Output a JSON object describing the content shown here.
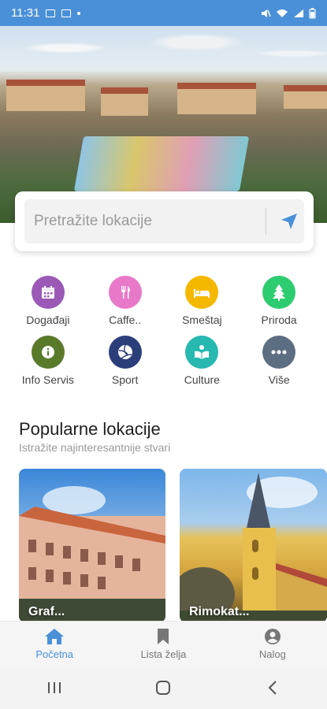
{
  "status_bar": {
    "time": "11:31"
  },
  "colors": {
    "accent": "#4a90d9",
    "statusbar": "#4a90d9"
  },
  "search": {
    "placeholder": "Pretražite lokacije",
    "locate_icon": "navigation-arrow-icon"
  },
  "categories": [
    {
      "label": "Događaji",
      "icon": "calendar-icon",
      "color": "#9b59b6"
    },
    {
      "label": "Caffe..",
      "icon": "cutlery-icon",
      "color": "#e879c9"
    },
    {
      "label": "Smeštaj",
      "icon": "bed-icon",
      "color": "#f5b800"
    },
    {
      "label": "Priroda",
      "icon": "tree-icon",
      "color": "#2ecc71"
    },
    {
      "label": "Info Servis",
      "icon": "info-icon",
      "color": "#5a7a2a"
    },
    {
      "label": "Sport",
      "icon": "volleyball-icon",
      "color": "#2c3e7a"
    },
    {
      "label": "Culture",
      "icon": "book-reader-icon",
      "color": "#27b8b0"
    },
    {
      "label": "Više",
      "icon": "more-dots-icon",
      "color": "#5e6e82"
    }
  ],
  "popular": {
    "title": "Popularne lokacije",
    "subtitle": "Istražite najinteresantnije stvari",
    "cards": [
      {
        "label": "Graf..."
      },
      {
        "label": "Rimokat..."
      }
    ]
  },
  "bottom_nav": [
    {
      "label": "Početna",
      "icon": "home-icon",
      "active": true
    },
    {
      "label": "Lista želja",
      "icon": "bookmark-icon",
      "active": false
    },
    {
      "label": "Nalog",
      "icon": "user-icon",
      "active": false
    }
  ]
}
